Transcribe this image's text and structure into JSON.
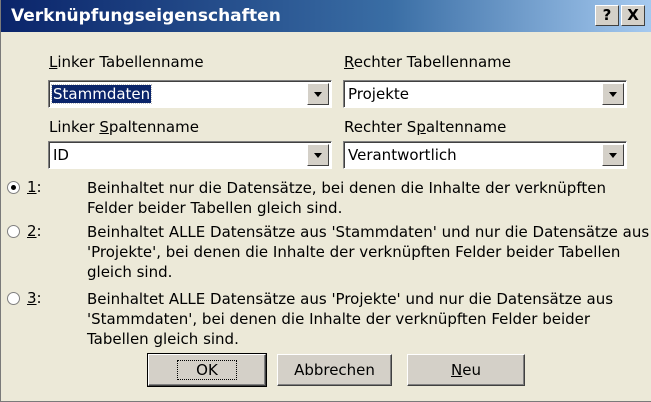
{
  "window": {
    "title": "Verknüpfungseigenschaften",
    "help_label": "?",
    "close_label": "X"
  },
  "left": {
    "table_label": {
      "mn": "L",
      "rest": "inker Tabellenname"
    },
    "table_value": "Stammdaten",
    "column_label": {
      "pre": "Linker ",
      "mn": "S",
      "rest": "paltenname"
    },
    "column_value": "ID"
  },
  "right": {
    "table_label": {
      "mn": "R",
      "rest": "echter Tabellenname"
    },
    "table_value": "Projekte",
    "column_label": {
      "pre": "Rechter S",
      "mn": "p",
      "rest": "altenname"
    },
    "column_value": "Verantwortlich"
  },
  "options": [
    {
      "num": "1",
      "selected": true,
      "lines": [
        "Beinhaltet nur die Datensätze, bei denen die Inhalte der verknüpften",
        "Felder beider Tabellen gleich sind."
      ]
    },
    {
      "num": "2",
      "selected": false,
      "lines": [
        "Beinhaltet ALLE Datensätze aus 'Stammdaten' und nur die Datensätze aus",
        "'Projekte', bei denen die Inhalte der verknüpften Felder beider Tabellen",
        "gleich sind."
      ]
    },
    {
      "num": "3",
      "selected": false,
      "lines": [
        "Beinhaltet ALLE Datensätze aus 'Projekte' und nur die Datensätze aus",
        "'Stammdaten', bei denen die Inhalte der verknüpften Felder beider",
        "Tabellen gleich sind."
      ]
    }
  ],
  "buttons": {
    "ok": "OK",
    "cancel": "Abbrechen",
    "new": {
      "mn": "N",
      "rest": "eu"
    }
  }
}
